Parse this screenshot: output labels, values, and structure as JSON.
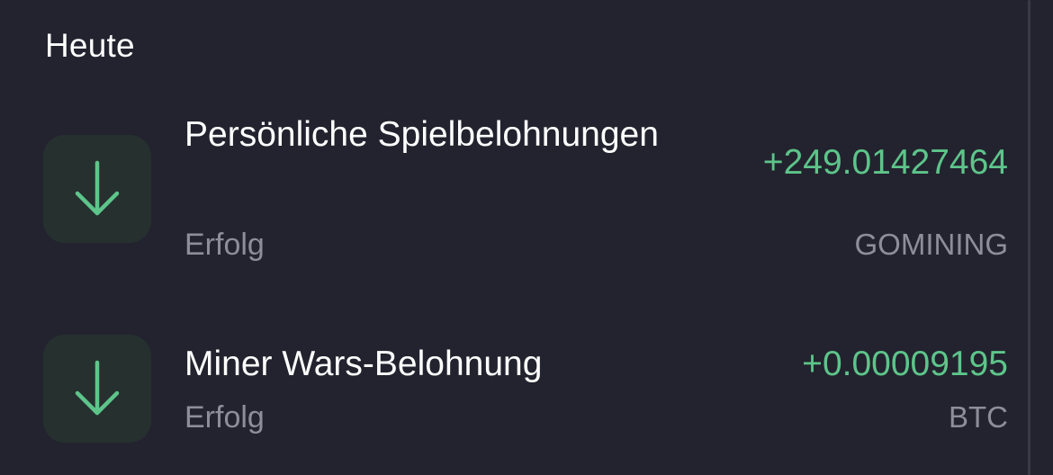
{
  "section": {
    "title": "Heute"
  },
  "transactions": [
    {
      "title": "Persönliche Spielbelohnungen",
      "status": "Erfolg",
      "amount": "+249.01427464",
      "currency": "GOMINING",
      "icon": "arrow-down-icon"
    },
    {
      "title": "Miner Wars-Belohnung",
      "status": "Erfolg",
      "amount": "+0.00009195",
      "currency": "BTC",
      "icon": "arrow-down-icon"
    }
  ],
  "colors": {
    "background": "#23232f",
    "icon_background": "#26302f",
    "accent_green": "#5dc58a",
    "muted_text": "#8e8e9a"
  }
}
